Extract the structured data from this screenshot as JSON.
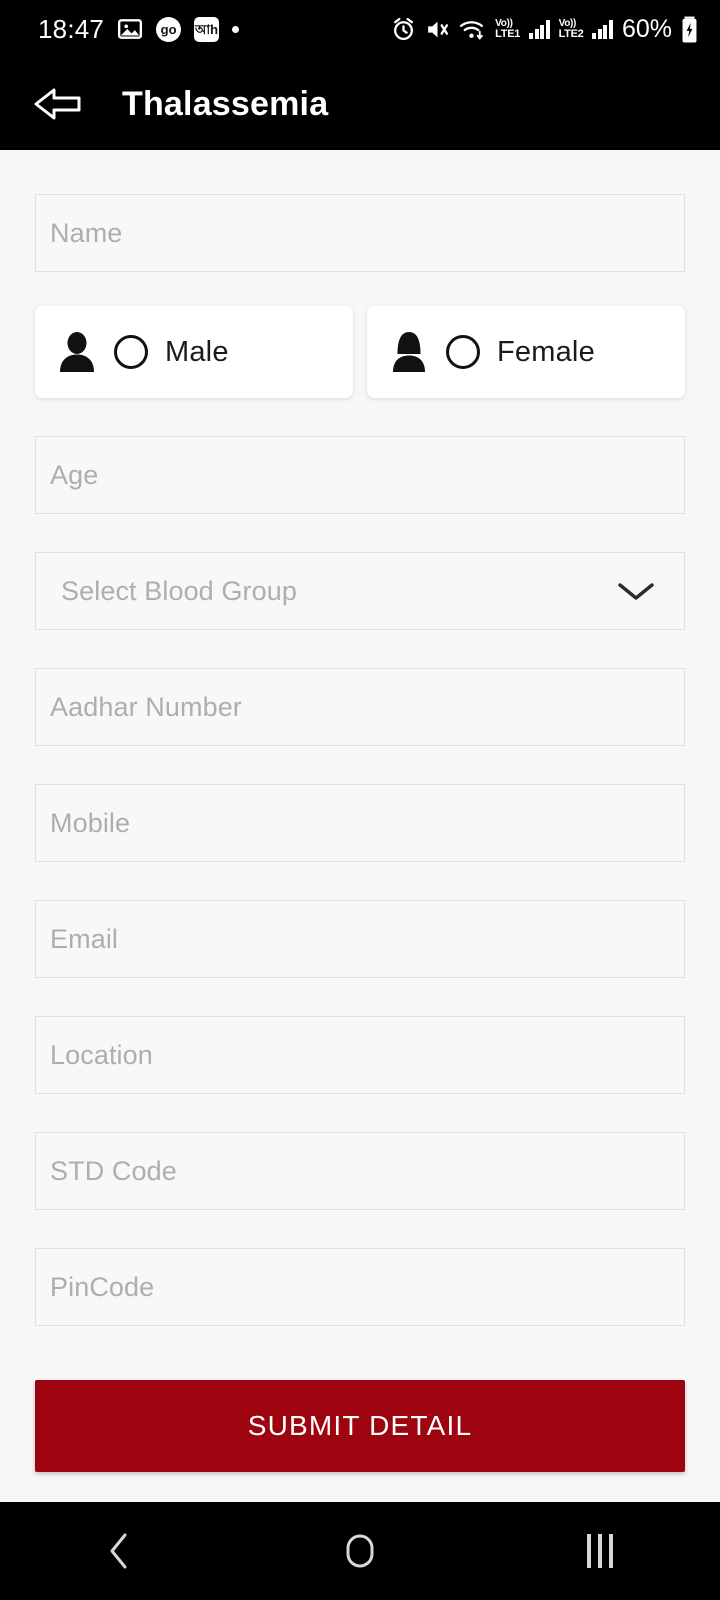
{
  "status_bar": {
    "time": "18:47",
    "icons_left": [
      "gallery-icon",
      "go-app-icon",
      "dh-app-icon",
      "dot-icon"
    ],
    "go_badge": "go",
    "dh_badge": "আh",
    "icons_right": [
      "alarm-icon",
      "mute-icon",
      "wifi-icon"
    ],
    "volte1_top": "Vo))",
    "volte1_bottom": "LTE1",
    "volte2_top": "Vo))",
    "volte2_bottom": "LTE2",
    "battery": "60%",
    "battery_icon": "battery-charging-icon"
  },
  "app_bar": {
    "back_icon": "back-arrow-icon",
    "title": "Thalassemia"
  },
  "form": {
    "name": {
      "placeholder": "Name",
      "value": ""
    },
    "gender": {
      "male": {
        "label": "Male",
        "icon": "male-person-icon",
        "selected": false
      },
      "female": {
        "label": "Female",
        "icon": "female-person-icon",
        "selected": false
      }
    },
    "age": {
      "placeholder": "Age",
      "value": ""
    },
    "blood_group": {
      "placeholder": "Select Blood Group",
      "value": "",
      "icon": "chevron-down-icon"
    },
    "aadhar": {
      "placeholder": "Aadhar Number",
      "value": ""
    },
    "mobile": {
      "placeholder": "Mobile",
      "value": ""
    },
    "email": {
      "placeholder": "Email",
      "value": ""
    },
    "location": {
      "placeholder": "Location",
      "value": ""
    },
    "std_code": {
      "placeholder": "STD Code",
      "value": ""
    },
    "pincode": {
      "placeholder": "PinCode",
      "value": ""
    }
  },
  "submit": {
    "label": "SUBMIT DETAIL"
  },
  "nav_bar": {
    "back": "nav-back-icon",
    "home": "nav-home-icon",
    "recents": "nav-recents-icon"
  },
  "colors": {
    "accent_red": "#9e0410",
    "page_background": "#f7f7f7",
    "bar_black": "#000000",
    "placeholder_gray": "#aeaeae",
    "field_border": "#e2e2e2"
  }
}
